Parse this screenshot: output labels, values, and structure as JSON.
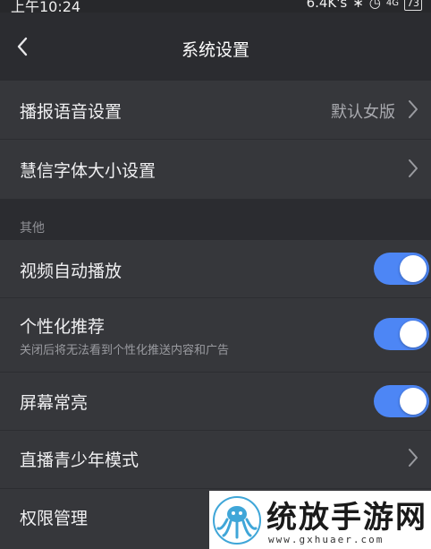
{
  "status_bar": {
    "time": "上午10:24",
    "net_speed": "6.4K's",
    "signal": "4G",
    "battery": "73"
  },
  "header": {
    "title": "系统设置"
  },
  "settings": {
    "voice": {
      "label": "播报语音设置",
      "value": "默认女版"
    },
    "font": {
      "label": "慧信字体大小设置"
    }
  },
  "other": {
    "section_title": "其他",
    "autoplay": {
      "label": "视频自动播放",
      "enabled": true
    },
    "personalized": {
      "label": "个性化推荐",
      "sublabel": "关闭后将无法看到个性化推送内容和广告",
      "enabled": true
    },
    "screen_on": {
      "label": "屏幕常亮",
      "enabled": true
    },
    "teen_mode": {
      "label": "直播青少年模式"
    },
    "permissions": {
      "label": "权限管理"
    }
  },
  "watermark": {
    "brand": "统放手游网",
    "url": "www.gxhuaer.com"
  },
  "colors": {
    "background": "#2b2c30",
    "card": "#36373b",
    "toggle_on": "#4d86f5"
  }
}
